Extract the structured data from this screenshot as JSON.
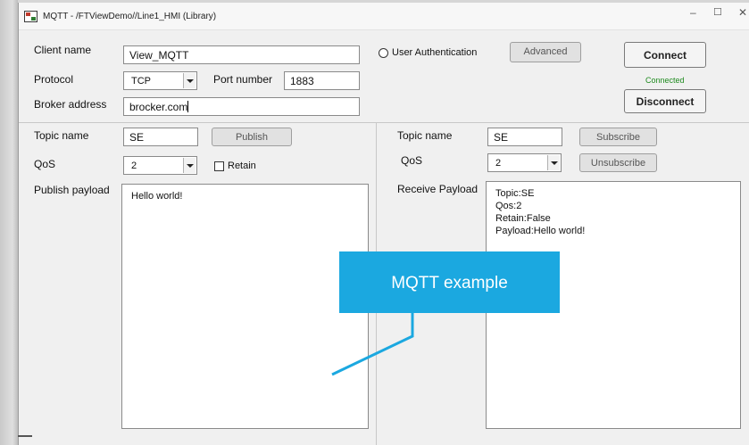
{
  "window": {
    "title": "MQTT - /FTViewDemo//Line1_HMI (Library)",
    "minimize": "–",
    "maximize": "☐",
    "close": "✕"
  },
  "connection": {
    "client_name_label": "Client name",
    "client_name_value": "View_MQTT",
    "protocol_label": "Protocol",
    "protocol_value": "TCP",
    "port_label": "Port number",
    "port_value": "1883",
    "broker_label": "Broker address",
    "broker_value": "brocker.com",
    "user_auth_label": "User Authentication",
    "advanced_label": "Advanced",
    "connect_label": "Connect",
    "status": "Connected",
    "disconnect_label": "Disconnect"
  },
  "publish": {
    "topic_label": "Topic name",
    "topic_value": "SE",
    "publish_label": "Publish",
    "qos_label": "QoS",
    "qos_value": "2",
    "retain_label": "Retain",
    "payload_label": "Publish payload",
    "payload_text": "Hello world!"
  },
  "subscribe": {
    "topic_label": "Topic name",
    "topic_value": "SE",
    "subscribe_label": "Subscribe",
    "qos_label": "QoS",
    "qos_value": "2",
    "unsubscribe_label": "Unsubscribe",
    "payload_label": "Receive Payload",
    "payload_lines": [
      "Topic:SE",
      "Qos:2",
      "Retain:False",
      "Payload:Hello world!"
    ]
  },
  "overlay": {
    "callout_text": "MQTT example",
    "callout_color": "#1ba8e0"
  },
  "colors": {
    "status_green": "#1e8a1e"
  }
}
